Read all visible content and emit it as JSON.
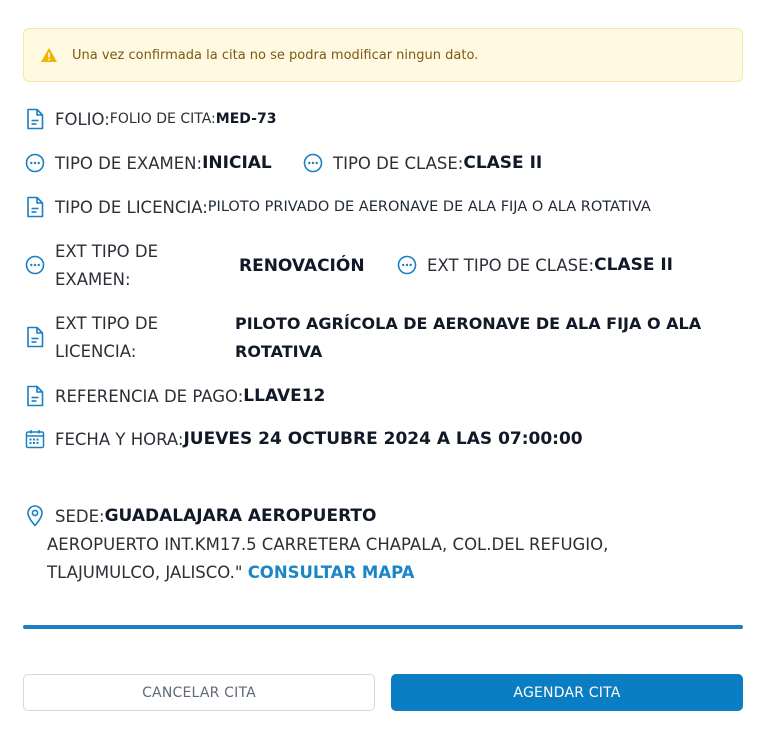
{
  "alert": {
    "message": "Una vez confirmada la cita no se podra modificar ningun dato.",
    "icon": "warning-icon",
    "icon_color": "#f0b400"
  },
  "folio": {
    "label": "FOLIO:",
    "sublabel": "FOLIO DE CITA: ",
    "value": "MED-73",
    "icon": "document-icon"
  },
  "tipo_examen": {
    "label": "TIPO DE EXAMEN:",
    "value": "INICIAL",
    "icon": "dots-circle-icon"
  },
  "tipo_clase": {
    "label": "TIPO DE CLASE:",
    "value": "CLASE II",
    "icon": "dots-circle-icon"
  },
  "tipo_licencia": {
    "label": "TIPO DE LICENCIA:",
    "value": "PILOTO PRIVADO DE AERONAVE DE ALA FIJA O ALA ROTATIVA",
    "icon": "document-icon"
  },
  "ext_tipo_examen": {
    "label_line1": "EXT TIPO DE",
    "label_line2": "EXAMEN:",
    "value": "RENOVACIÓN",
    "icon": "dots-circle-icon"
  },
  "ext_tipo_clase": {
    "label": "EXT TIPO DE CLASE:",
    "value": "CLASE II",
    "icon": "dots-circle-icon"
  },
  "ext_tipo_licencia": {
    "label_line1": "EXT TIPO DE",
    "label_line2": "LICENCIA:",
    "value_line1": "PILOTO AGRÍCOLA DE AERONAVE DE ALA FIJA O ALA",
    "value_line2": "ROTATIVA",
    "icon": "document-icon"
  },
  "referencia_pago": {
    "label": "REFERENCIA DE PAGO:",
    "value": "LLAVE12",
    "icon": "document-icon"
  },
  "fecha_hora": {
    "label": "FECHA Y HORA:",
    "value": "JUEVES 24 OCTUBRE 2024 A LAS 07:00:00",
    "icon": "calendar-icon"
  },
  "sede": {
    "label": "SEDE:",
    "value": "GUADALAJARA AEROPUERTO",
    "address_line1": "AEROPUERTO INT.KM17.5 CARRETERA CHAPALA, COL.DEL REFUGIO,",
    "address_line2": "TLAJUMULCO, JALISCO.\" ",
    "map_link": "CONSULTAR MAPA",
    "icon": "location-pin-icon"
  },
  "buttons": {
    "cancel": "CANCELAR CITA",
    "confirm": "AGENDAR CITA"
  },
  "colors": {
    "icon_blue": "#1a7fc3",
    "primary": "#0b7dc3",
    "alert_bg": "#fff9e1"
  }
}
